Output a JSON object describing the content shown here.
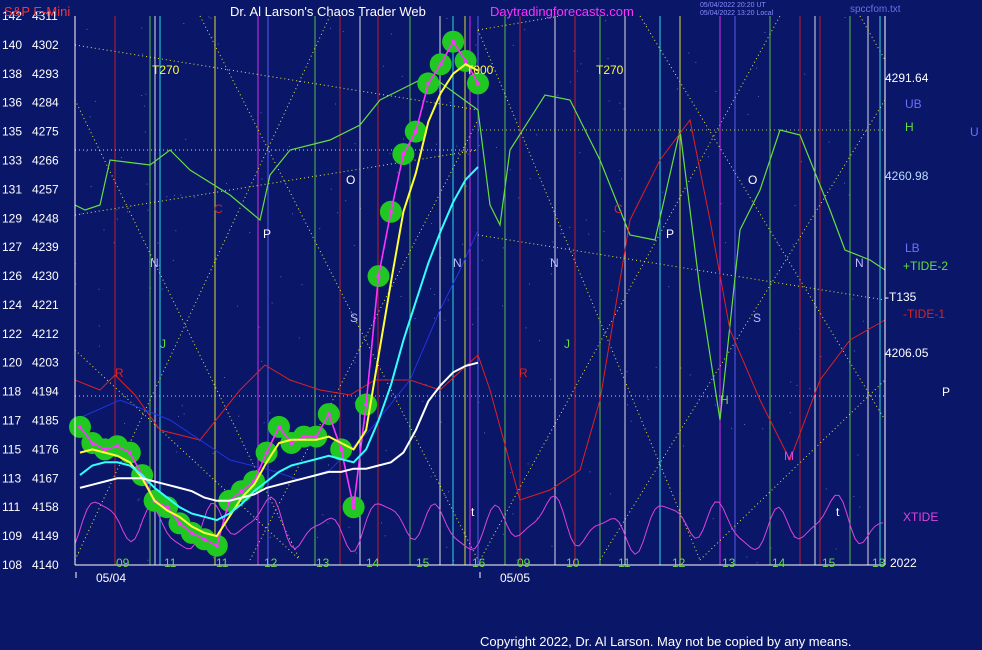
{
  "header": {
    "symbol": "S&P E-Mini",
    "title": "Dr. Al Larson's Chaos Trader Web",
    "site": "Daytradingforecasts.com",
    "stamp_line1": "05/04/2022 20:20 UT",
    "stamp_line2": "05/04/2022 13:20 Local",
    "file": "spccfom.txt"
  },
  "copyright": "Copyright 2022, Dr. Al Larson. May not be copied by any means.",
  "colors": {
    "background": "#0a1668",
    "price_glow": "#22c822",
    "price_line": "#ff33ff",
    "moving_avg_yellow": "#ffff33",
    "moving_avg_white": "#ffffff",
    "moving_avg_cyan": "#33ffff",
    "tide_green": "#66dd44",
    "tide_red": "#dd2222",
    "xtide_magenta": "#dd44dd",
    "axis_label": "#ffffff",
    "header_symbol": "#ff3333",
    "header_title": "#ffffff",
    "header_site": "#ff33ff"
  },
  "chart_data": {
    "type": "line",
    "title": "S&P E-Mini",
    "y_axis": {
      "ticks": [
        {
          "left": "108",
          "right": "4140"
        },
        {
          "left": "109",
          "right": "4149"
        },
        {
          "left": "111",
          "right": "4158"
        },
        {
          "left": "113",
          "right": "4167"
        },
        {
          "left": "115",
          "right": "4176"
        },
        {
          "left": "117",
          "right": "4185"
        },
        {
          "left": "118",
          "right": "4194"
        },
        {
          "left": "120",
          "right": "4203"
        },
        {
          "left": "122",
          "right": "4212"
        },
        {
          "left": "124",
          "right": "4221"
        },
        {
          "left": "126",
          "right": "4230"
        },
        {
          "left": "127",
          "right": "4239"
        },
        {
          "left": "129",
          "right": "4248"
        },
        {
          "left": "131",
          "right": "4257"
        },
        {
          "left": "133",
          "right": "4266"
        },
        {
          "left": "135",
          "right": "4275"
        },
        {
          "left": "136",
          "right": "4284"
        },
        {
          "left": "138",
          "right": "4293"
        },
        {
          "left": "140",
          "right": "4302"
        },
        {
          "left": "142",
          "right": "4311"
        }
      ],
      "range": [
        4140,
        4311
      ]
    },
    "x_axis": {
      "hour_labels": [
        "09",
        "11",
        "11",
        "12",
        "13",
        "14",
        "15",
        "16",
        "09",
        "10",
        "11",
        "12",
        "13",
        "14",
        "15",
        "13"
      ],
      "date_labels": [
        "05/04",
        "05/05"
      ],
      "year_label": "2022"
    },
    "right_labels": {
      "upper_value": "4291.64",
      "mid_value": "4260.98",
      "lower_value": "4206.05",
      "ub": "UB",
      "h": "H",
      "lb": "LB",
      "tide_plus": "+TIDE-2",
      "t135": "-T135",
      "tide_minus": "-TIDE-1",
      "p": "P",
      "xtide": "XTIDE",
      "u": "U"
    },
    "annotations": [
      "T270",
      "T000",
      "T270",
      "N",
      "N",
      "N",
      "N",
      "P",
      "P",
      "O",
      "O",
      "S",
      "S",
      "C",
      "C",
      "J",
      "J",
      "R",
      "R",
      "H",
      "M",
      "t",
      "t"
    ],
    "series": [
      {
        "name": "S&P E-Mini",
        "x": [
          "09:00",
          "09:15",
          "09:30",
          "09:45",
          "10:00",
          "10:15",
          "10:30",
          "10:45",
          "11:00",
          "11:15",
          "11:30",
          "11:45",
          "12:00",
          "12:15",
          "12:30",
          "12:45",
          "13:00",
          "13:15",
          "13:30",
          "13:45",
          "14:00",
          "14:10",
          "14:20",
          "14:30",
          "14:40",
          "14:50",
          "15:00",
          "15:10",
          "15:20",
          "15:30",
          "15:40",
          "15:50",
          "16:00"
        ],
        "values": [
          4183,
          4178,
          4176,
          4177,
          4175,
          4168,
          4160,
          4158,
          4153,
          4150,
          4148,
          4146,
          4160,
          4163,
          4166,
          4175,
          4183,
          4178,
          4180,
          4180,
          4187,
          4176,
          4158,
          4190,
          4230,
          4250,
          4268,
          4275,
          4290,
          4296,
          4303,
          4297,
          4290
        ]
      },
      {
        "name": "Moving Average (yellow)",
        "values": [
          4175,
          4176,
          4175,
          4174,
          4172,
          4167,
          4160,
          4157,
          4155,
          4152,
          4150,
          4149,
          4155,
          4161,
          4165,
          4172,
          4178,
          4179,
          4179,
          4179,
          4180,
          4178,
          4176,
          4182,
          4205,
          4228,
          4250,
          4262,
          4278,
          4287,
          4293,
          4296,
          4294
        ]
      },
      {
        "name": "Moving Average (cyan)",
        "values": [
          4168,
          4171,
          4172,
          4172,
          4171,
          4168,
          4164,
          4161,
          4158,
          4156,
          4155,
          4154,
          4156,
          4159,
          4163,
          4166,
          4169,
          4171,
          4172,
          4173,
          4174,
          4173,
          4172,
          4176,
          4185,
          4196,
          4210,
          4222,
          4234,
          4244,
          4253,
          4260,
          4264
        ]
      },
      {
        "name": "Moving Average (white)",
        "values": [
          4164,
          4165,
          4166,
          4167,
          4167,
          4167,
          4166,
          4165,
          4164,
          4163,
          4161,
          4160,
          4160,
          4161,
          4162,
          4164,
          4165,
          4166,
          4167,
          4168,
          4169,
          4169,
          4170,
          4170,
          4171,
          4172,
          4175,
          4182,
          4191,
          4196,
          4200,
          4202,
          4203
        ]
      }
    ]
  }
}
